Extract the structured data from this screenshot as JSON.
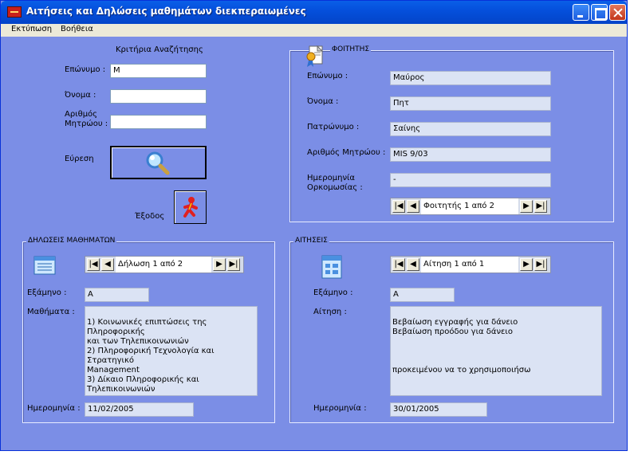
{
  "window": {
    "title": "Αιτήσεις και Δηλώσεις μαθημάτων διεκπεραιωμένες"
  },
  "menu": {
    "items": [
      "Εκτύπωση",
      "Βοήθεια"
    ]
  },
  "search": {
    "heading": "Κριτήρια Αναζήτησης",
    "surname_label": "Επώνυμο :",
    "surname_value": "Μ",
    "firstname_label": "Όνομα :",
    "firstname_value": "",
    "regno_label_1": "Αριθμός",
    "regno_label_2": "Μητρώου :",
    "regno_value": "",
    "find_label": "Εύρεση",
    "exit_label": "Έξοδος"
  },
  "student": {
    "group_title": "ΦΟΙΤΗΤΗΣ",
    "surname_label": "Επώνυμο :",
    "surname_value": "Μαύρος",
    "firstname_label": "Όνομα :",
    "firstname_value": "Πητ",
    "father_label": "Πατρώνυμο :",
    "father_value": "Σαίνης",
    "regno_label": "Αριθμός Μητρώου :",
    "regno_value": "MIS 9/03",
    "oath_label_1": "Ημερομηνία",
    "oath_label_2": "Ορκομωσίας :",
    "oath_value": "-",
    "nav_text": "Φοιτητής 1 από 2"
  },
  "declarations": {
    "group_title": "ΔΗΛΩΣΕΙΣ ΜΑΘΗΜΑΤΩΝ",
    "nav_text": "Δήλωση 1 από 2",
    "semester_label": "Εξάμηνο :",
    "semester_value": "Α",
    "courses_label": "Μαθήματα :",
    "courses_lines": [
      "",
      "1) Κοινωνικές επιπτώσεις της Πληροφορικής",
      "και των Τηλεπικοινωνιών",
      "2) Πληροφορική Τεχνολογία και Στρατηγικό",
      "Management",
      "3) Δίκαιο Πληροφορικής και",
      "Τηλεπικοινωνιών"
    ],
    "date_label": "Ημερομηνία :",
    "date_value": "11/02/2005"
  },
  "requests": {
    "group_title": "ΑΙΤΗΣΕΙΣ",
    "nav_text": "Αίτηση 1 από 1",
    "semester_label": "Εξάμηνο :",
    "semester_value": "Α",
    "request_label": "Αίτηση :",
    "request_lines": [
      "",
      "Βεβαίωση εγγραφής για δάνειο",
      "Βεβαίωση προόδου για δάνειο",
      "",
      "",
      "",
      "προκειμένου να το χρησιμοποιήσω"
    ],
    "date_label": "Ημερομηνία :",
    "date_value": "30/01/2005"
  },
  "nav_glyphs": {
    "first": "|◀",
    "prev": "◀",
    "next": "▶",
    "last": "▶|"
  },
  "icons": [
    "app-key-icon",
    "magnifier-icon",
    "exit-figure-icon",
    "student-certificate-icon",
    "declaration-form-icon",
    "request-form-icon"
  ]
}
